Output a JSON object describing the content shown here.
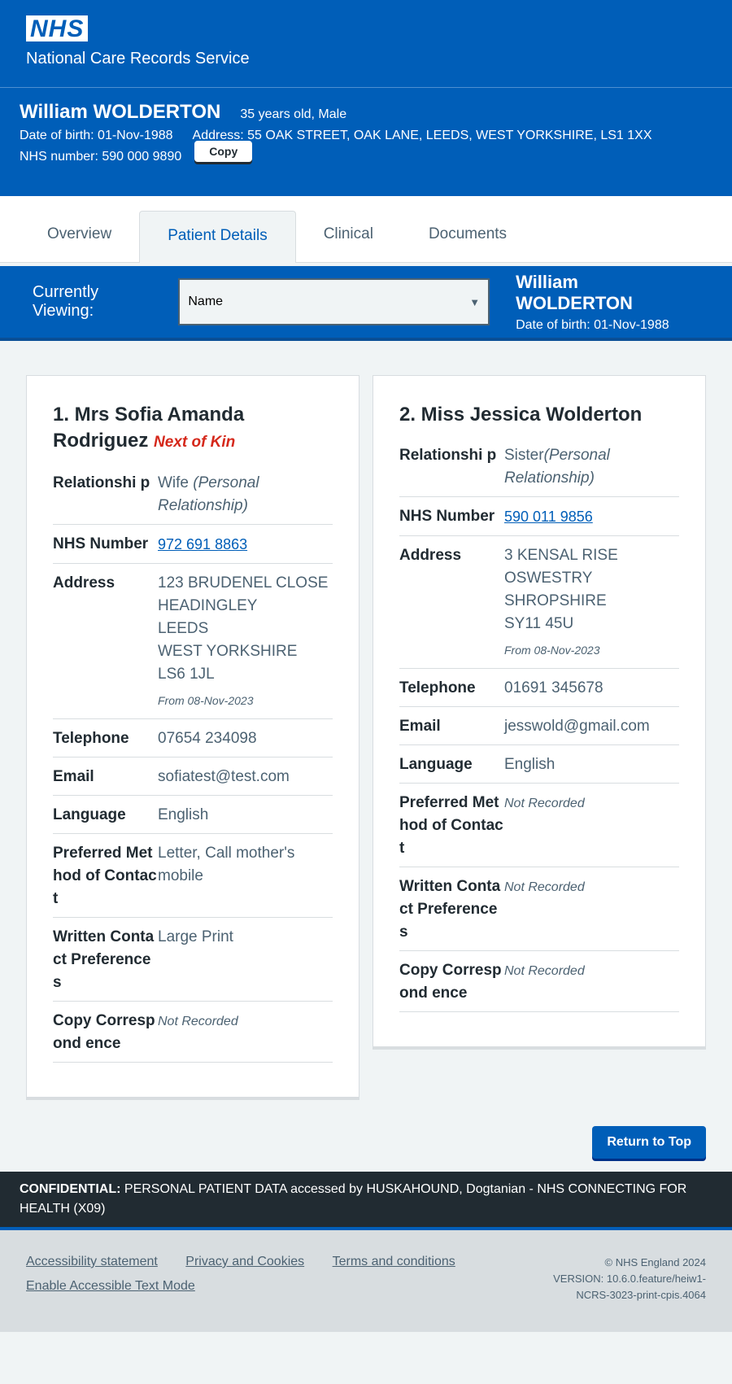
{
  "header": {
    "logo": "NHS",
    "service_name": "National Care Records Service"
  },
  "patient": {
    "name": "William WOLDERTON",
    "age_sex": "35 years old, Male",
    "dob": "Date of birth: 01-Nov-1988",
    "address": "Address: 55 OAK STREET, OAK LANE, LEEDS, WEST YORKSHIRE, LS1 1XX",
    "nhs_number": "NHS number: 590 000 9890",
    "copy_label": "Copy"
  },
  "tabs": [
    {
      "label": "Overview"
    },
    {
      "label": "Patient Details"
    },
    {
      "label": "Clinical"
    },
    {
      "label": "Documents"
    }
  ],
  "viewing": {
    "label": "Currently Viewing:",
    "selected": "Name",
    "person_name": "William WOLDERTON",
    "person_dob": "Date of birth: 01-Nov-1988"
  },
  "contacts": [
    {
      "title": "1. Mrs Sofia Amanda Rodriguez",
      "badge": "Next of Kin",
      "labels": {
        "relationship": "Relationshi p",
        "nhs": "NHS Number",
        "address": "Address",
        "telephone": "Telephone",
        "email": "Email",
        "language": "Language",
        "preferred": "Preferred Method of Contact",
        "written": "Written Contact Preferences",
        "copy": "Copy Correspond ence"
      },
      "relationship": "Wife",
      "relationship_type": "(Personal Relationship)",
      "nhs_number": "972 691 8863",
      "address_lines": [
        "123 BRUDENEL CLOSE",
        "HEADINGLEY",
        "LEEDS",
        "WEST YORKSHIRE",
        "LS6 1JL"
      ],
      "address_from": "From 08-Nov-2023",
      "telephone": "07654 234098",
      "email": "sofiatest@test.com",
      "language": "English",
      "preferred_contact": "Letter, Call mother's mobile",
      "written_prefs": "Large Print",
      "copy_correspondence": "Not Recorded"
    },
    {
      "title": "2. Miss Jessica Wolderton",
      "labels": {
        "relationship": "Relationshi p",
        "nhs": "NHS Number",
        "address": "Address",
        "telephone": "Telephone",
        "email": "Email",
        "language": "Language",
        "preferred": "Preferred Method of Contact",
        "written": "Written Contact Preferences",
        "copy": "Copy Correspond ence"
      },
      "relationship": "Sister",
      "relationship_type": "(Personal Relationship)",
      "nhs_number": "590 011 9856",
      "address_lines": [
        "3 KENSAL RISE",
        "OSWESTRY",
        "SHROPSHIRE",
        "SY11 45U"
      ],
      "address_from": "From 08-Nov-2023",
      "telephone": "01691 345678",
      "email": "jesswold@gmail.com",
      "language": "English",
      "preferred_contact": "Not Recorded",
      "written_prefs": "Not Recorded",
      "copy_correspondence": "Not Recorded"
    }
  ],
  "return_to_top": "Return to Top",
  "confidential": {
    "label": "CONFIDENTIAL:",
    "text": "PERSONAL PATIENT DATA accessed by HUSKAHOUND, Dogtanian - NHS CONNECTING FOR HEALTH (X09)"
  },
  "footer": {
    "links": [
      "Accessibility statement",
      "Privacy and Cookies",
      "Terms and conditions",
      "Enable Accessible Text Mode"
    ],
    "copyright": "© NHS England 2024",
    "version": "VERSION: 10.6.0.feature/heiw1-NCRS-3023-print-cpis.4064"
  }
}
